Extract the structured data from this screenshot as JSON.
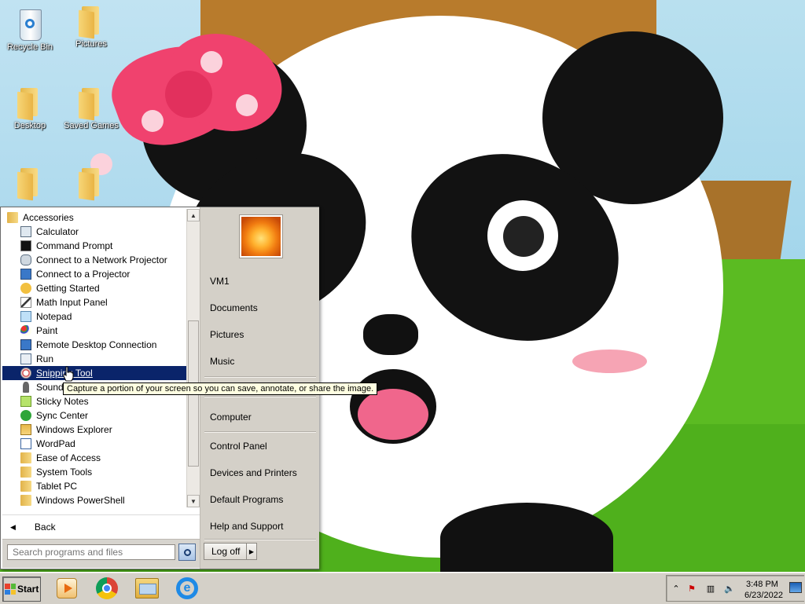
{
  "desktop": {
    "icons": [
      {
        "label": "Recycle Bin",
        "icon": "recycle-bin-icon"
      },
      {
        "label": "Pictures",
        "icon": "folder-icon"
      },
      {
        "label": "Desktop",
        "icon": "folder-icon"
      },
      {
        "label": "Saved Games",
        "icon": "folder-icon"
      },
      {
        "label": "",
        "icon": "folder-icon"
      },
      {
        "label": "",
        "icon": "folder-icon"
      }
    ]
  },
  "start_menu": {
    "programs": [
      {
        "label": "Accessories",
        "icon": "folder-icon"
      },
      {
        "label": "Calculator",
        "icon": "calculator-icon"
      },
      {
        "label": "Command Prompt",
        "icon": "command-prompt-icon"
      },
      {
        "label": "Connect to a Network Projector",
        "icon": "network-projector-icon"
      },
      {
        "label": "Connect to a Projector",
        "icon": "projector-icon"
      },
      {
        "label": "Getting Started",
        "icon": "getting-started-icon"
      },
      {
        "label": "Math Input Panel",
        "icon": "math-input-icon"
      },
      {
        "label": "Notepad",
        "icon": "notepad-icon"
      },
      {
        "label": "Paint",
        "icon": "paint-icon"
      },
      {
        "label": "Remote Desktop Connection",
        "icon": "remote-desktop-icon"
      },
      {
        "label": "Run",
        "icon": "run-icon"
      },
      {
        "label": "Snipping Tool",
        "icon": "snipping-tool-icon"
      },
      {
        "label": "Sound Recorder",
        "icon": "microphone-icon"
      },
      {
        "label": "Sticky Notes",
        "icon": "sticky-notes-icon"
      },
      {
        "label": "Sync Center",
        "icon": "sync-center-icon"
      },
      {
        "label": "Windows Explorer",
        "icon": "windows-explorer-icon"
      },
      {
        "label": "WordPad",
        "icon": "wordpad-icon"
      },
      {
        "label": "Ease of Access",
        "icon": "folder-icon"
      },
      {
        "label": "System Tools",
        "icon": "folder-icon"
      },
      {
        "label": "Tablet PC",
        "icon": "folder-icon"
      },
      {
        "label": "Windows PowerShell",
        "icon": "folder-icon"
      }
    ],
    "selected_program": "Snipping Tool",
    "tooltip": "Capture a portion of your screen so you can save, annotate, or share the image.",
    "back_label": "Back",
    "search_placeholder": "Search programs and files",
    "right_pane": {
      "user": "VM1",
      "items": [
        "Documents",
        "Pictures",
        "Music",
        "Computer",
        "Control Panel",
        "Devices and Printers",
        "Default Programs",
        "Help and Support"
      ]
    },
    "logoff_label": "Log off"
  },
  "taskbar": {
    "start_label": "Start",
    "pinned": [
      "windows-media-player-icon",
      "chrome-icon",
      "windows-explorer-icon",
      "internet-explorer-icon"
    ],
    "clock_time": "3:48 PM",
    "clock_date": "6/23/2022"
  },
  "colors": {
    "selection": "#0a246a",
    "menu_right_bg": "#d4d0c8",
    "tooltip_bg": "#ffffe1"
  }
}
